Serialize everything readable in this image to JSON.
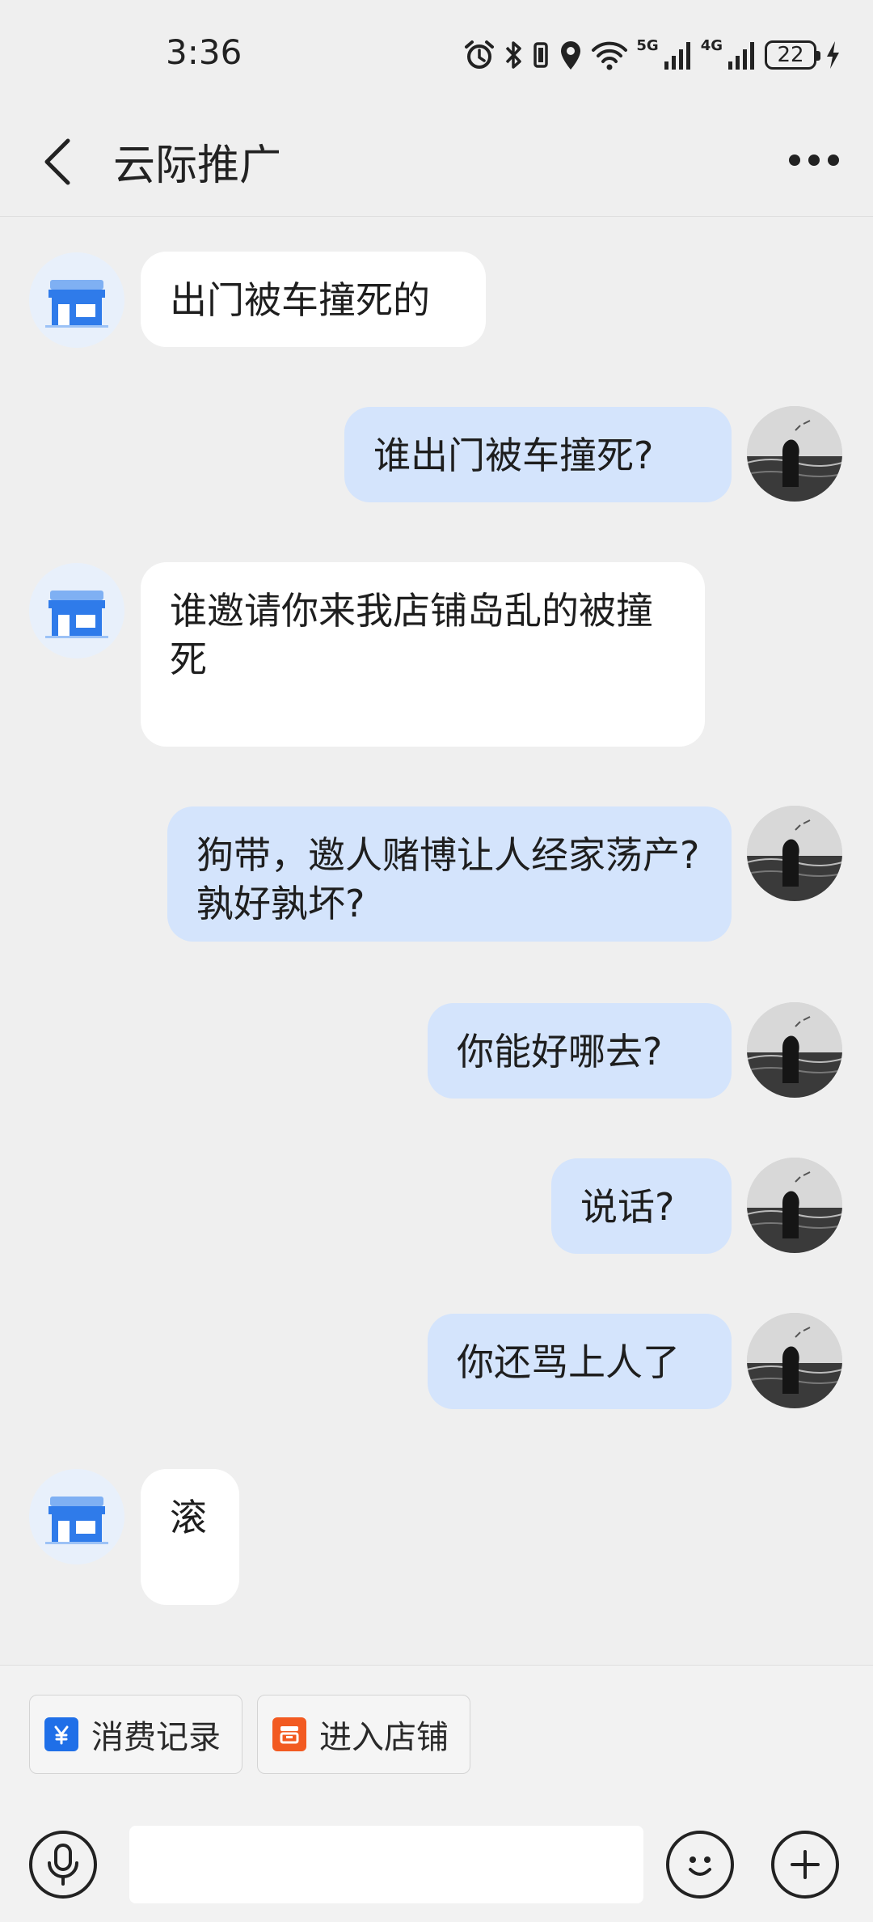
{
  "status_bar": {
    "time": "3:36",
    "battery": "22",
    "sim1_label": "5G",
    "sim2_label": "4G",
    "icons": [
      "alarm-icon",
      "bluetooth-icon",
      "vibrate-icon",
      "location-icon",
      "wifi-icon",
      "signal-icon",
      "battery-icon",
      "charging-icon"
    ]
  },
  "header": {
    "title": "云际推广",
    "back_icon": "chevron-left-icon",
    "more_icon": "more-dots-icon"
  },
  "messages": [
    {
      "side": "left",
      "sender": "shop",
      "text": "出门被车撞死的"
    },
    {
      "side": "right",
      "sender": "user",
      "text": "谁出门被车撞死?"
    },
    {
      "side": "left",
      "sender": "shop",
      "text": "谁邀请你来我店铺岛乱的被撞死"
    },
    {
      "side": "right",
      "sender": "user",
      "text": "狗带，邀人赌博让人经家荡产?孰好孰坏?"
    },
    {
      "side": "right",
      "sender": "user",
      "text": "你能好哪去?"
    },
    {
      "side": "right",
      "sender": "user",
      "text": "说话?"
    },
    {
      "side": "right",
      "sender": "user",
      "text": "你还骂上人了"
    },
    {
      "side": "left",
      "sender": "shop",
      "text": "滚"
    }
  ],
  "quick_actions": {
    "consumption_label": "消费记录",
    "enter_store_label": "进入店铺"
  },
  "input": {
    "placeholder": "",
    "value": ""
  },
  "colors": {
    "background": "#efefef",
    "bubble_left": "#ffffff",
    "bubble_right": "#d4e4fc",
    "shop_blue": "#2f7bea",
    "store_orange": "#f25a21"
  }
}
